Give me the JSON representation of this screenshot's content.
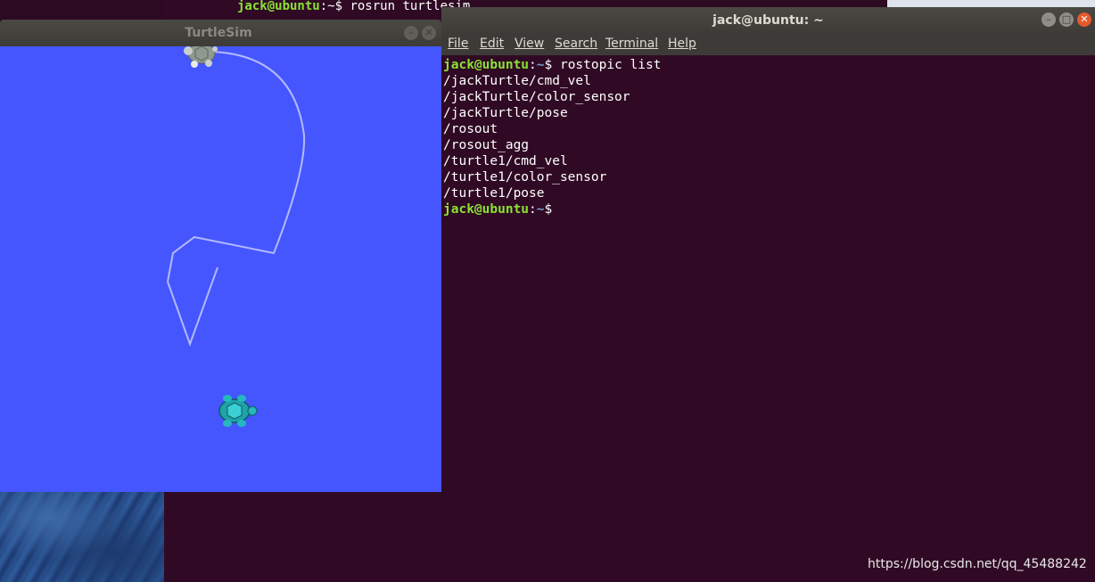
{
  "background_terminal": {
    "line1_user": "jack@ubuntu",
    "line1_sep": ":~$ ",
    "line1_cmd": "rosrun turtlesim"
  },
  "terminal": {
    "title": "jack@ubuntu: ~",
    "menu": [
      "File",
      "Edit",
      "View",
      "Search",
      "Terminal",
      "Help"
    ],
    "prompt_user": "jack@ubuntu",
    "prompt_sep": ":",
    "prompt_path": "~",
    "prompt_dollar": "$ ",
    "command": "rostopic list",
    "output": [
      "/jackTurtle/cmd_vel",
      "/jackTurtle/color_sensor",
      "/jackTurtle/pose",
      "/rosout",
      "/rosout_agg",
      "/turtle1/cmd_vel",
      "/turtle1/color_sensor",
      "/turtle1/pose"
    ]
  },
  "turtlesim": {
    "title": "TurtleSim",
    "background_color": "#4556ff",
    "pen_color": "#b3b8ff"
  },
  "watermark": "https://blog.csdn.net/qq_45488242"
}
